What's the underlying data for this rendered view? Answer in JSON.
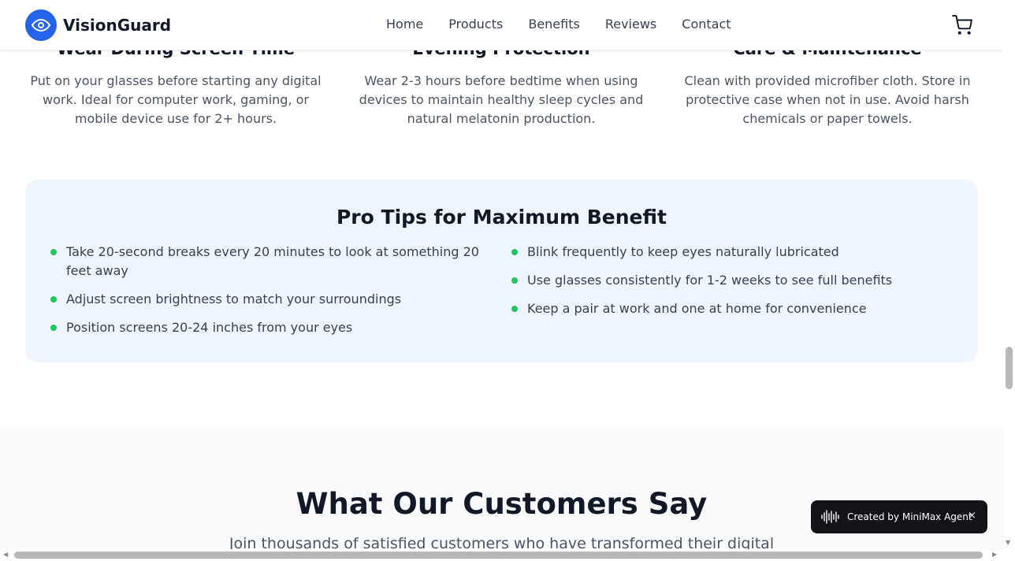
{
  "header": {
    "brand": "VisionGuard",
    "nav": [
      "Home",
      "Products",
      "Benefits",
      "Reviews",
      "Contact"
    ]
  },
  "usage": [
    {
      "title": "Wear During Screen Time",
      "text": "Put on your glasses before starting any digital work. Ideal for computer work, gaming, or mobile device use for 2+ hours."
    },
    {
      "title": "Evening Protection",
      "text": "Wear 2-3 hours before bedtime when using devices to maintain healthy sleep cycles and natural melatonin production."
    },
    {
      "title": "Care & Maintenance",
      "text": "Clean with provided microfiber cloth. Store in protective case when not in use. Avoid harsh chemicals or paper towels."
    }
  ],
  "tips": {
    "title": "Pro Tips for Maximum Benefit",
    "left": [
      "Take 20-second breaks every 20 minutes to look at something 20 feet away",
      "Adjust screen brightness to match your surroundings",
      "Position screens 20-24 inches from your eyes"
    ],
    "right": [
      "Blink frequently to keep eyes naturally lubricated",
      "Use glasses consistently for 1-2 weeks to see full benefits",
      "Keep a pair at work and one at home for convenience"
    ]
  },
  "testimonials": {
    "title": "What Our Customers Say",
    "subtitle": "Join thousands of satisfied customers who have transformed their digital"
  },
  "badge": {
    "text": "Created by MiniMax Agent",
    "close": "×"
  },
  "colors": {
    "accent": "#2563eb",
    "bullet": "#22c55e",
    "tips_bg": "#eef5ff"
  },
  "icons": {
    "logo": "eye-icon",
    "cart": "cart-icon",
    "badge": "waveform-icon"
  }
}
